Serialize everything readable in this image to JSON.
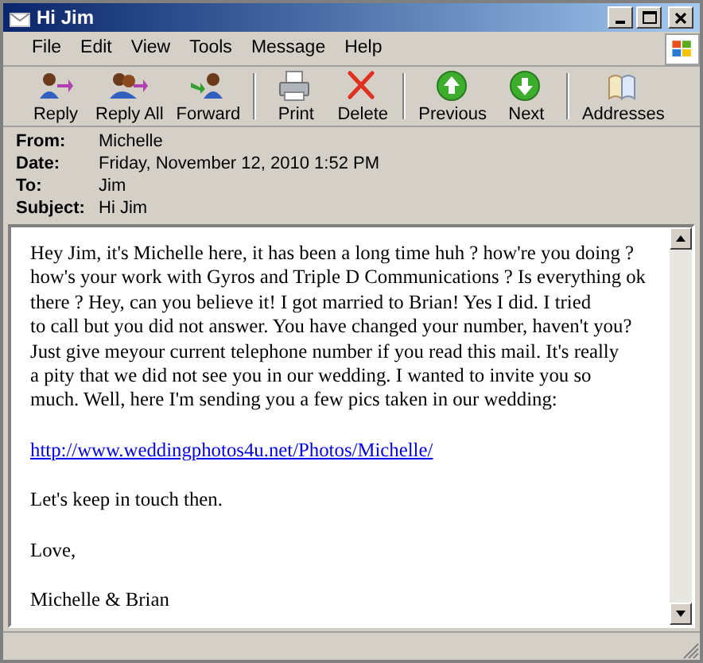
{
  "window": {
    "title": "Hi Jim"
  },
  "menu": [
    "File",
    "Edit",
    "View",
    "Tools",
    "Message",
    "Help"
  ],
  "toolbar": [
    {
      "kind": "reply",
      "label": "Reply"
    },
    {
      "kind": "reply_all",
      "label": "Reply All"
    },
    {
      "kind": "forward",
      "label": "Forward"
    },
    {
      "kind": "print",
      "label": "Print"
    },
    {
      "kind": "delete",
      "label": "Delete"
    },
    {
      "kind": "previous",
      "label": "Previous"
    },
    {
      "kind": "next",
      "label": "Next"
    },
    {
      "kind": "addresses",
      "label": "Addresses"
    }
  ],
  "headers": [
    {
      "label": "From:",
      "value": "Michelle"
    },
    {
      "label": "Date:",
      "value": "Friday, November 12, 2010 1:52 PM"
    },
    {
      "label": "To:",
      "value": "Jim"
    },
    {
      "label": "Subject:",
      "value": "Hi Jim"
    }
  ],
  "body": [
    {
      "kind": "text",
      "text": "Hey Jim, it's Michelle here, it has been a long time huh ? how're you doing ?\nhow's your work with Gyros and Triple D Communications ? Is everything ok\nthere ? Hey, can you believe it! I got married to Brian! Yes I did. I tried\nto call but you did not answer. You have changed your number, haven't you?\nJust give meyour current telephone number if you read this mail. It's really\na pity that we did not see you in our wedding. I wanted to invite you so\nmuch. Well, here I'm sending you a few pics taken in our wedding:"
    },
    {
      "kind": "link",
      "text": "http://www.weddingphotos4u.net/Photos/Michelle/"
    },
    {
      "kind": "text",
      "text": "Let's keep in touch then."
    },
    {
      "kind": "text",
      "text": "Love,"
    },
    {
      "kind": "text",
      "text": "Michelle & Brian"
    }
  ]
}
